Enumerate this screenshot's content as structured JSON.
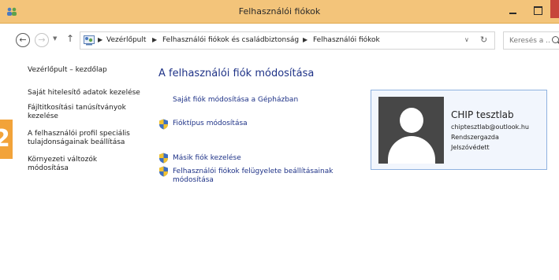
{
  "window": {
    "title": "Felhasználói fiókok",
    "title_bar_color": "#f3c47a",
    "close_button_color": "#c7453b"
  },
  "navigation": {
    "back_symbol": "←",
    "forward_symbol": "→",
    "up_symbol": "↑",
    "breadcrumb": [
      "Vezérlőpult",
      "Felhasználói fiókok és családbiztonság",
      "Felhasználói fiókok"
    ],
    "search_placeholder": "Keresés a ..."
  },
  "sidebar": {
    "home_link": "Vezérlőpult – kezdőlap",
    "links": [
      "Saját hitelesítő adatok kezelése",
      "Fájltitkosítási tanúsítványok kezelése",
      "A felhasználói profil speciális tulajdonságainak beállítása",
      "Környezeti változók módosítása"
    ],
    "tab_badge": "2",
    "tab_color": "#f2a33a"
  },
  "main": {
    "heading": "A felhasználói fiók módosítása",
    "tasks": [
      {
        "label": "Saját fiók módosítása a Gépházban",
        "icon": "none"
      },
      {
        "label": "Fióktípus módosítása",
        "icon": "uac-shield-icon"
      },
      {
        "label": "Másik fiók kezelése",
        "icon": "uac-shield-icon"
      },
      {
        "label": "Felhasználói fiókok felügyelete beállításainak módosítása",
        "icon": "uac-shield-icon"
      }
    ],
    "link_color": "#1e3287"
  },
  "user": {
    "name": "CHIP tesztlab",
    "email": "chiptesztlab@outlook.hu",
    "role": "Rendszergazda",
    "protection": "Jelszóvédett",
    "avatar_icon": "default-user-avatar-icon"
  }
}
